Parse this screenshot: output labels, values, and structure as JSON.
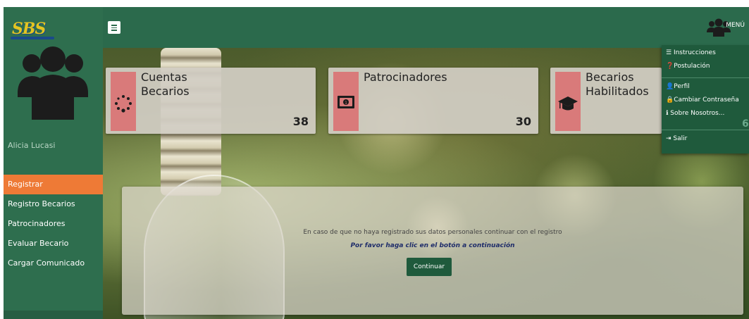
{
  "app": {
    "logo_text": "SBS"
  },
  "sidebar": {
    "username": "Alicia Lucasi",
    "items": [
      {
        "label": "Registrar",
        "active": true
      },
      {
        "label": "Registro Becarios",
        "active": false
      },
      {
        "label": "Patrocinadores",
        "active": false
      },
      {
        "label": "Evaluar Becario",
        "active": false
      },
      {
        "label": "Cargar Comunicado",
        "active": false
      }
    ]
  },
  "header": {
    "menu_label": "MENÚ"
  },
  "cards": [
    {
      "title_line1": "Cuentas",
      "title_line2": "Becarios",
      "count": "38",
      "icon": "dots-circle-icon"
    },
    {
      "title_line1": "Patrocinadores",
      "title_line2": "",
      "count": "30",
      "icon": "money-icon"
    },
    {
      "title_line1": "Becarios",
      "title_line2": "Habilitados",
      "count": "6",
      "icon": "graduation-cap-icon"
    }
  ],
  "dropdown": {
    "items": [
      {
        "label": "Instrucciones",
        "icon": "list-icon"
      },
      {
        "label": "Postulación",
        "icon": "question-icon"
      },
      {
        "label": "Perfil",
        "icon": "user-icon"
      },
      {
        "label": "Cambiar Contraseña",
        "icon": "lock-icon"
      },
      {
        "label": "Sobre Nosotros...",
        "icon": "info-icon"
      },
      {
        "label": "Salir",
        "icon": "sign-out-icon"
      }
    ]
  },
  "panel": {
    "message": "En caso de que no haya registrado sus datos personales continuar con el registro",
    "instruction": "Por favor haga clic en el botón a continuación",
    "button_label": "Continuar"
  },
  "colors": {
    "sidebar": "#2e6e4e",
    "active": "#ee7a36",
    "card_icon_box": "#d97a7a",
    "button": "#1f5a3c"
  }
}
